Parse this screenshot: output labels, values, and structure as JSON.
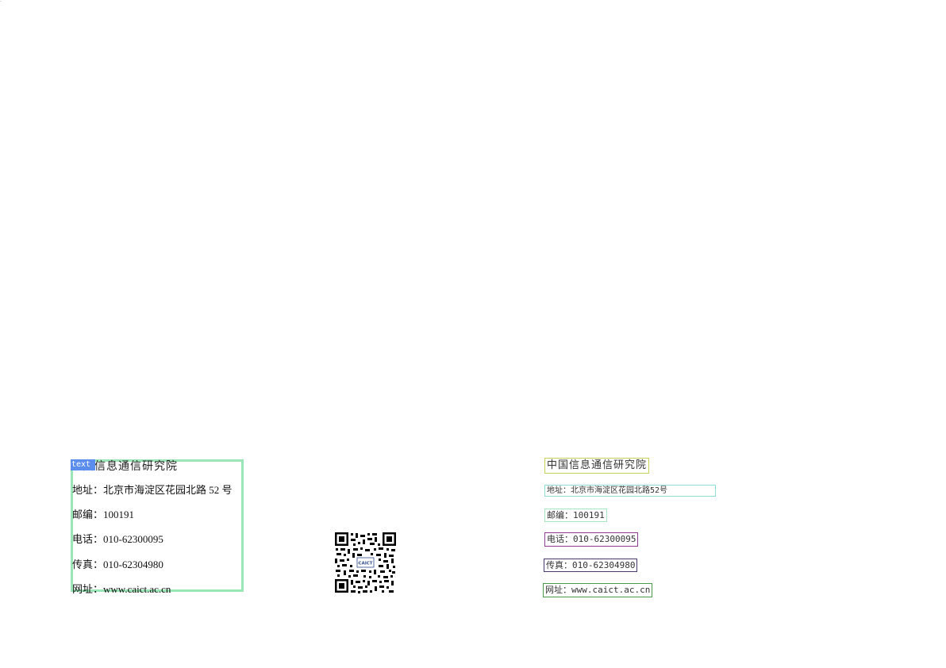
{
  "left": {
    "tag": "text",
    "title": "中国信息通信研究院",
    "address": "地址：北京市海淀区花园北路 52 号",
    "zip": "邮编：100191",
    "phone": "电话：010-62300095",
    "fax": "传真：010-62304980",
    "website": "网址：www.caict.ac.cn"
  },
  "qr": {
    "icon": "qr-code-icon",
    "logo_text": "CAICT"
  },
  "right": {
    "title": "中国信息通信研究院",
    "address": "地址：北京市海淀区花园北路52号",
    "zip": "邮编：100191",
    "phone": "电话：010-62300095",
    "fax": "传真：010-62304980",
    "website": "网址：www.caict.ac.cn"
  }
}
